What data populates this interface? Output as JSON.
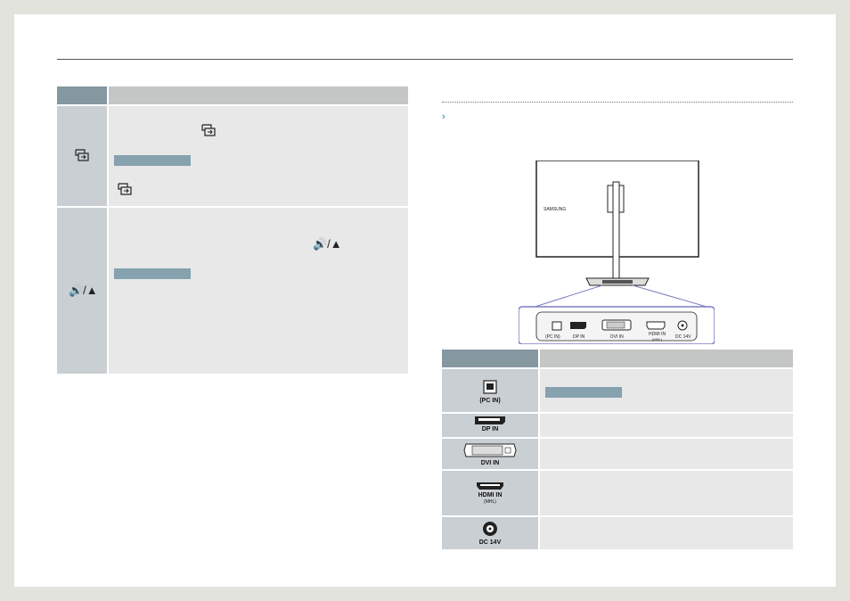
{
  "left_table": {
    "rows": [
      {
        "icon": "source-icon",
        "inline_icon": "source-icon",
        "bottom_icon": "source-icon"
      },
      {
        "icon": "volume-up-icon",
        "symbol": "🔊/▲",
        "inline_symbol": "🔊/▲"
      }
    ]
  },
  "connection_illustration": {
    "brand_text": "SAMSUNG",
    "ports": {
      "usb": "(PC IN)",
      "dp": "DP IN",
      "dvi": "DVI IN",
      "hdmi": "HDMI IN",
      "hdmi_sub": "(MHL)",
      "dc": "DC 14V"
    }
  },
  "port_table": {
    "rows": [
      {
        "label": "(PC IN)",
        "icon": "usb-b-port-icon"
      },
      {
        "label": "DP IN",
        "icon": "displayport-icon"
      },
      {
        "label": "DVI IN",
        "icon": "dvi-port-icon"
      },
      {
        "label": "HDMI IN",
        "sub_label": "(MHL)",
        "icon": "hdmi-port-icon"
      },
      {
        "label": "DC 14V",
        "icon": "dc-power-port-icon"
      }
    ]
  },
  "colors": {
    "header_dark": "#85979f",
    "header_light": "#c4c6c6",
    "icon_cell": "#c9cfd2",
    "content_cell": "#e8e8e8",
    "note_bar": "#85a2ae",
    "accent_blue": "#1e7fa8",
    "highlight_purple": "#7a7ec0"
  }
}
